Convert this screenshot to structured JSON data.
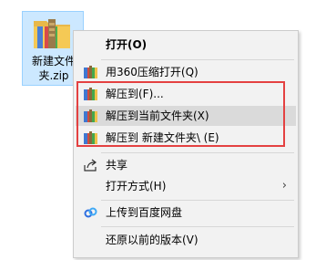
{
  "desktop": {
    "file_name": "新建文件\n夹.zip",
    "file_icon": "winrar-archive-icon"
  },
  "context_menu": {
    "items": [
      {
        "label": "打开(O)",
        "icon": null
      },
      {
        "label": "用360压缩打开(Q)",
        "icon": "archive-icon"
      },
      {
        "label": "解压到(F)...",
        "icon": "archive-icon"
      },
      {
        "label": "解压到当前文件夹(X)",
        "icon": "archive-icon"
      },
      {
        "label": "解压到 新建文件夹\\ (E)",
        "icon": "archive-icon"
      },
      {
        "label": "共享",
        "icon": "share-icon"
      },
      {
        "label": "打开方式(H)",
        "icon": null,
        "submenu_arrow": "›"
      },
      {
        "label": "上传到百度网盘",
        "icon": "baidu-netdisk-icon"
      },
      {
        "label": "还原以前的版本(V)",
        "icon": null
      }
    ]
  },
  "colors": {
    "highlight_border": "#e44141",
    "hover_background": "#dadada",
    "menu_background": "#f2f2f2",
    "selection_background": "#cce8ff"
  }
}
